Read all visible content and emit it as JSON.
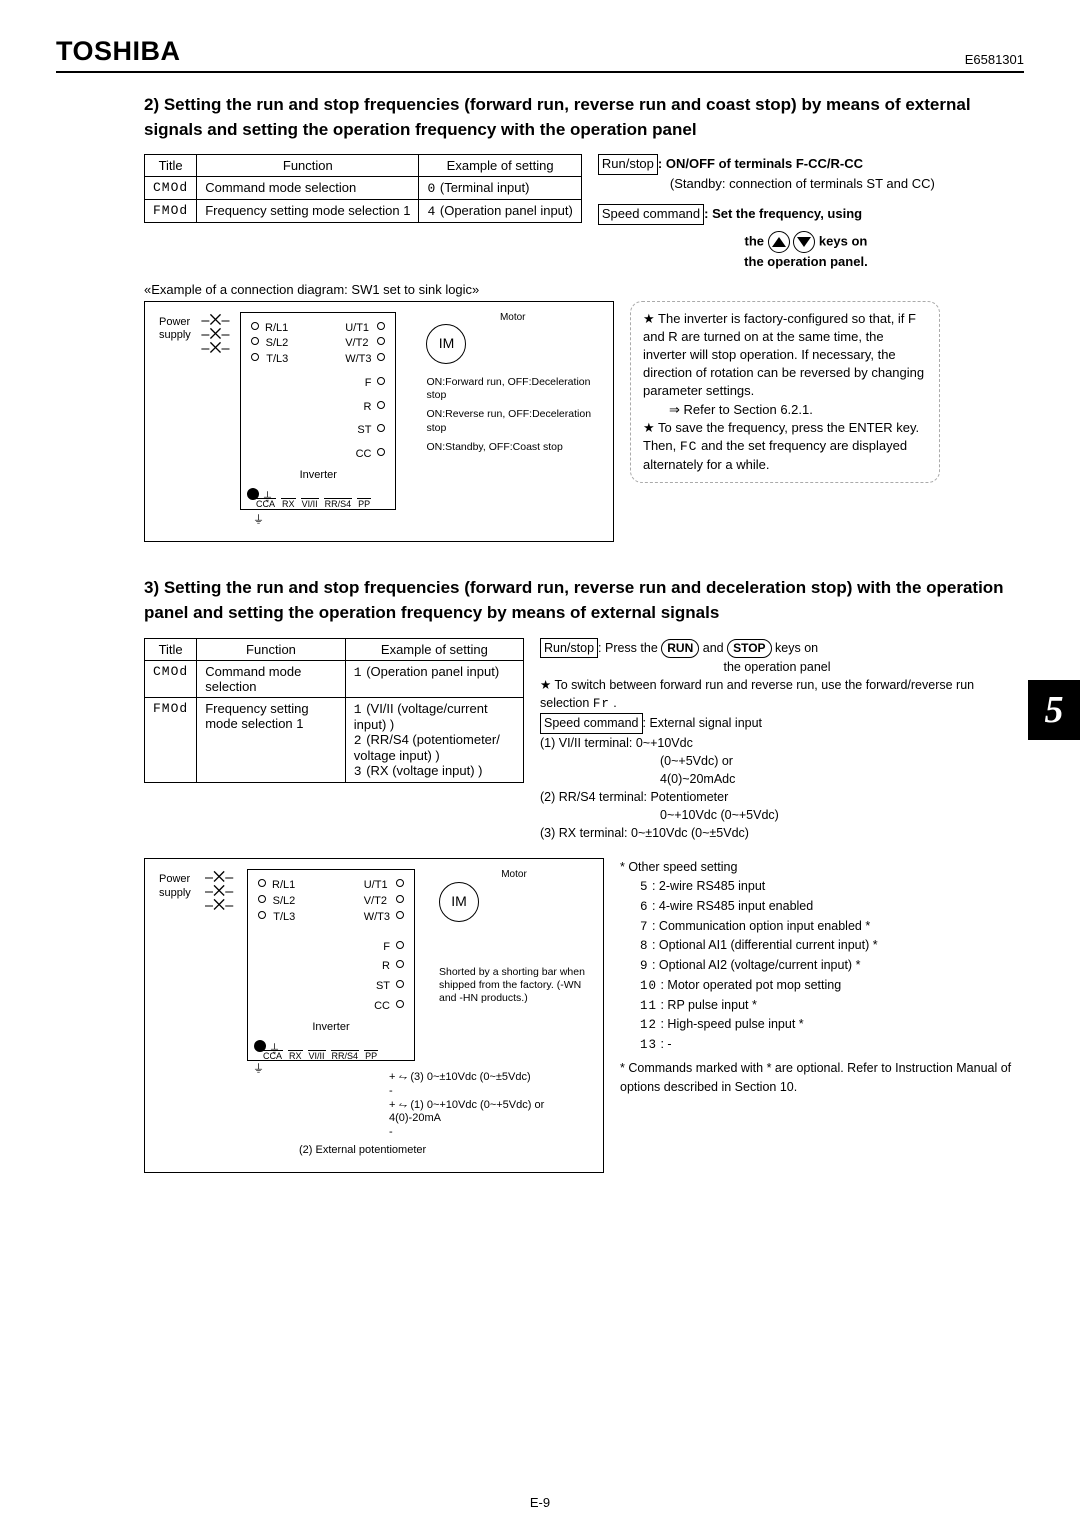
{
  "document_code": "E6581301",
  "brand": "TOSHIBA",
  "page_number_label": "E-9",
  "side_tab": "5",
  "section2": {
    "heading": "2) Setting the run and stop frequencies (forward run, reverse run and coast stop) by means of external signals and setting the operation frequency with the operation panel",
    "table": {
      "headers": [
        "Title",
        "Function",
        "Example of setting"
      ],
      "rows": [
        {
          "title": "CMOd",
          "function": "Command mode selection",
          "setting": "0  (Terminal input)"
        },
        {
          "title": "FMOd",
          "function": "Frequency setting mode selection 1",
          "setting": "4  (Operation panel input)"
        }
      ]
    },
    "runstop_label": "Run/stop",
    "runstop_text": ": ON/OFF of terminals F-CC/R-CC",
    "runstop_sub1": "(Standby: connection of terminals ST and CC)",
    "speed_label": "Speed command",
    "speed_text": ": Set the frequency, using",
    "speed_text2": "the",
    "speed_text3": "keys on",
    "speed_text4": "the operation panel.",
    "caption": "«Example of a connection diagram: SW1 set to sink logic»",
    "diagram": {
      "power_label": "Power supply",
      "inverter_label": "Inverter",
      "motor_label": "Motor",
      "im": "IM",
      "left_terms": [
        "R/L1",
        "S/L2",
        "T/L3"
      ],
      "right_terms": [
        "U/T1",
        "V/T2",
        "W/T3"
      ],
      "sig_terms": [
        "F",
        "R",
        "ST",
        "CC"
      ],
      "sig_desc": [
        "ON:Forward run, OFF:Deceleration stop",
        "ON:Reverse run, OFF:Deceleration stop",
        "ON:Standby, OFF:Coast stop"
      ],
      "bottom": [
        "CCA",
        "RX",
        "VI/II",
        "RR/S4",
        "PP"
      ]
    },
    "starbox": {
      "p1": "★ The inverter is factory-configured so that, if F and R are turned on at the same time, the inverter will stop operation. If necessary, the direction of rotation can be reversed by changing parameter settings.",
      "p2": "⇒ Refer to Section 6.2.1.",
      "p3_a": "★ To save the frequency, press the ENTER key. Then, ",
      "p3_seg": "FC",
      "p3_b": " and the set frequency are displayed alternately for a while."
    }
  },
  "section3": {
    "heading": "3) Setting the run and stop frequencies (forward run, reverse run and deceleration stop) with the operation panel and setting the operation frequency by means of external signals",
    "table": {
      "headers": [
        "Title",
        "Function",
        "Example of setting"
      ],
      "rows": [
        {
          "title": "CMOd",
          "function": "Command mode selection",
          "setting": "1 (Operation panel input)"
        },
        {
          "title": "FMOd",
          "function": "Frequency setting mode selection 1",
          "setting": "1 (VI/II (voltage/current input) )\n2 (RR/S4 (potentiometer/ voltage input) )\n3 (RX (voltage input) )"
        }
      ]
    },
    "runstop_label": "Run/stop",
    "runstop_text": ": Press the ",
    "runstop_mid": " and ",
    "runstop_end": " keys on",
    "runstop_sub": "the operation panel",
    "run_key": "RUN",
    "stop_key": "STOP",
    "switch_note_a": "★ To switch between forward run and reverse run, use the forward/reverse run selection ",
    "switch_seg": "Fr",
    "switch_note_b": " .",
    "speed_label": "Speed command",
    "speed_text": ": External signal input",
    "line1": "(1) VI/II terminal: 0~+10Vdc",
    "line1b": "(0~+5Vdc) or",
    "line1c": "4(0)~20mAdc",
    "line2": "(2) RR/S4 terminal: Potentiometer",
    "line2b": "0~+10Vdc (0~+5Vdc)",
    "line3": "(3) RX terminal:  0~±10Vdc (0~±5Vdc)",
    "diagram": {
      "power_label": "Power supply",
      "inverter_label": "Inverter",
      "motor_label": "Motor",
      "im": "IM",
      "left_terms": [
        "R/L1",
        "S/L2",
        "T/L3"
      ],
      "right_terms": [
        "U/T1",
        "V/T2",
        "W/T3"
      ],
      "sig_terms": [
        "F",
        "R",
        "ST",
        "CC"
      ],
      "short_note": "Shorted by a shorting bar when shipped from the factory. (-WN and -HN products.)",
      "bottom": [
        "CCA",
        "RX",
        "VI/II",
        "RR/S4",
        "PP"
      ],
      "pot_label": "(2) External potentiometer",
      "wire3": "(3) 0~±10Vdc (0~±5Vdc)",
      "wire1": "(1) 0~+10Vdc (0~+5Vdc) or 4(0)-20mA"
    },
    "other_speed": {
      "title": "* Other speed setting",
      "items": [
        "5 : 2-wire RS485 input",
        "6 : 4-wire RS485 input enabled",
        "7 : Communication option input enabled *",
        "8 : Optional AI1 (differential current input) *",
        "9 : Optional AI2 (voltage/current input) *",
        "10 : Motor operated pot mop setting",
        "11 : RP pulse input *",
        "12 : High-speed pulse input *",
        "13 : -"
      ],
      "footnote": "* Commands marked with * are optional. Refer to Instruction Manual of options described in Section 10."
    }
  }
}
